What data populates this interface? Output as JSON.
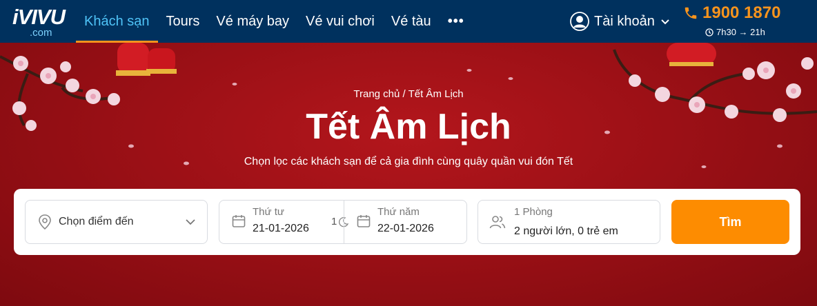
{
  "header": {
    "logo": {
      "brand": "iVIVU",
      "tld": ".com"
    },
    "nav": [
      {
        "label": "Khách sạn",
        "active": true
      },
      {
        "label": "Tours"
      },
      {
        "label": "Vé máy bay"
      },
      {
        "label": "Vé vui chơi"
      },
      {
        "label": "Vé tàu"
      }
    ],
    "more_label": "•••",
    "account_label": "Tài khoản",
    "hotline": {
      "phone": "1900 1870",
      "hours": "7h30 → 21h"
    }
  },
  "hero": {
    "breadcrumb": {
      "home": "Trang chủ",
      "separator": " / ",
      "current": "Tết Âm Lịch"
    },
    "title": "Tết Âm Lịch",
    "subtitle": "Chọn lọc các khách sạn để cả gia đình cùng quây quần vui đón Tết"
  },
  "search": {
    "destination_label": "Chọn điểm đến",
    "checkin": {
      "weekday": "Thứ tư",
      "date": "21-01-2026"
    },
    "nights": "1",
    "checkout": {
      "weekday": "Thứ năm",
      "date": "22-01-2026"
    },
    "rooms": "1 Phòng",
    "guests": "2 người lớn, 0 trẻ em",
    "button_label": "Tìm"
  },
  "colors": {
    "header_bg": "#00315e",
    "active_nav": "#4fc3f7",
    "accent_orange": "#fd8c01",
    "hero_red": "#9c1016"
  },
  "icons": [
    "user-icon",
    "chevron-down-icon",
    "phone-icon",
    "clock-icon",
    "location-pin-icon",
    "calendar-icon",
    "moon-icon",
    "users-icon"
  ]
}
